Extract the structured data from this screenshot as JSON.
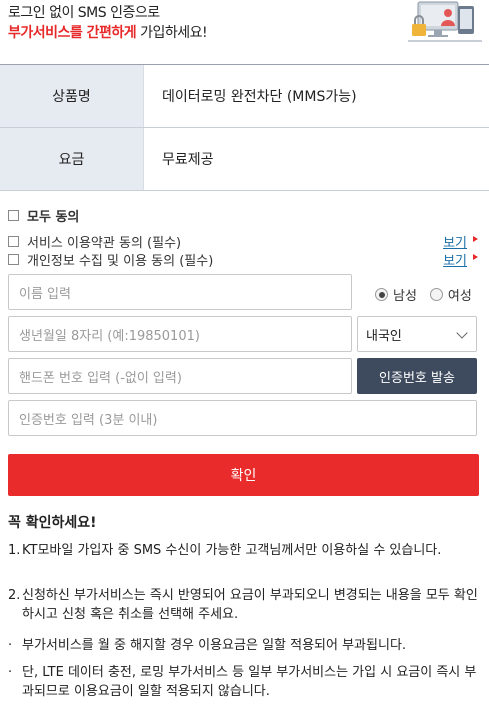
{
  "header": {
    "line1": "로그인 없이 SMS 인증으로",
    "line2_highlight": "부가서비스를 간편하게",
    "line2_rest": " 가입하세요!"
  },
  "product_table": {
    "rows": [
      {
        "label": "상품명",
        "value": "데이터로밍 완전차단 (MMS가능)"
      },
      {
        "label": "요금",
        "value": "무료제공"
      }
    ]
  },
  "agreements": {
    "all": "모두 동의",
    "terms": "서비스 이용약관 동의 (필수)",
    "privacy": "개인정보 수집 및 이용 동의 (필수)",
    "view_label": "보기"
  },
  "form": {
    "name_placeholder": "이름 입력",
    "gender_male": "남성",
    "gender_female": "여성",
    "gender_selected": "남성",
    "birth_placeholder": "생년월일 8자리 (예:19850101)",
    "nationality_selected": "내국인",
    "phone_placeholder": "핸드폰 번호 입력 (-없이 입력)",
    "send_code_label": "인증번호 발송",
    "code_placeholder": "인증번호 입력 (3분 이내)",
    "confirm_label": "확인"
  },
  "notice": {
    "title": "꼭 확인하세요!",
    "items": [
      {
        "marker": "1.",
        "text": "KT모바일 가입자 중 SMS 수신이 가능한 고객님께서만 이용하실 수 있습니다."
      },
      {
        "marker": "2.",
        "text": "신청하신 부가서비스는 즉시 반영되어 요금이 부과되오니 변경되는 내용을 모두 확인하시고 신청 혹은 취소를 선택해 주세요."
      },
      {
        "marker": "·",
        "text": "부가서비스를 월 중 해지할 경우 이용요금은 일할 적용되어 부과됩니다."
      },
      {
        "marker": "·",
        "text": "단, LTE 데이터 충전, 로밍 부가서비스 등 일부 부가서비스는 가입 시 요금이 즉시 부과되므로 이용요금이 일할 적용되지 않습니다."
      }
    ]
  },
  "colors": {
    "accent_red": "#ea2b2b",
    "button_dark": "#3e4a5e",
    "table_header_bg": "#e6ebf1",
    "link_blue": "#1b6fa8"
  }
}
